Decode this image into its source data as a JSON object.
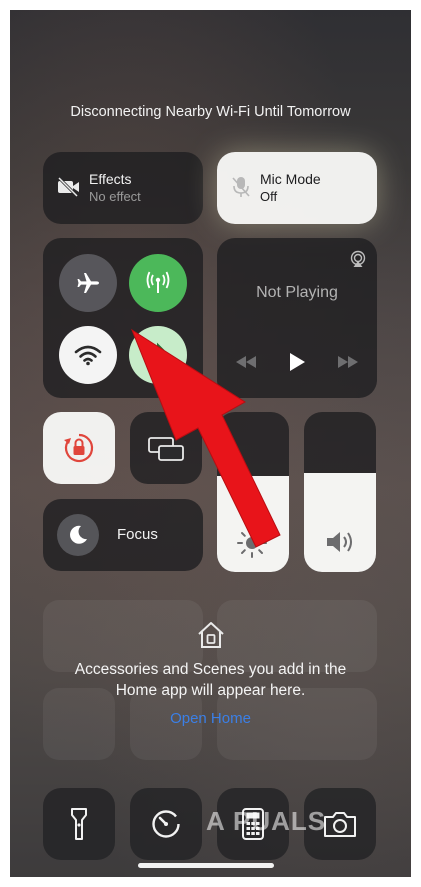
{
  "status_message": "Disconnecting Nearby Wi-Fi Until Tomorrow",
  "effects": {
    "title": "Effects",
    "subtitle": "No effect",
    "icon": "video-off-icon"
  },
  "mic_mode": {
    "title": "Mic Mode",
    "subtitle": "Off",
    "icon": "mic-off-icon"
  },
  "connectivity": {
    "airplane": {
      "icon": "airplane-icon",
      "state": "off"
    },
    "cellular": {
      "icon": "cellular-antenna-icon",
      "state": "on",
      "color": "#4cb85a"
    },
    "wifi": {
      "icon": "wifi-icon",
      "state": "on"
    },
    "bluetooth": {
      "icon": "bluetooth-icon",
      "state": "on"
    }
  },
  "media": {
    "label": "Not Playing",
    "icons": [
      "airplay-icon",
      "rewind-icon",
      "play-icon",
      "fast-forward-icon"
    ]
  },
  "orientation_lock": {
    "icon": "rotation-lock-icon",
    "color": "#e0463c"
  },
  "screen_mirroring": {
    "icon": "screen-mirroring-icon"
  },
  "focus": {
    "label": "Focus",
    "icon": "moon-icon"
  },
  "brightness": {
    "level": 0.6,
    "icon": "sun-icon"
  },
  "volume": {
    "level": 0.62,
    "icon": "speaker-icon"
  },
  "home": {
    "icon": "home-icon",
    "message_line1": "Accessories and Scenes you add in the",
    "message_line2": "Home app will appear here.",
    "link": "Open Home"
  },
  "bottom_buttons": [
    "flashlight-icon",
    "timer-icon",
    "calculator-icon",
    "camera-icon"
  ],
  "watermark": "A  PUALS",
  "annotation_arrow_color": "#e8141a"
}
